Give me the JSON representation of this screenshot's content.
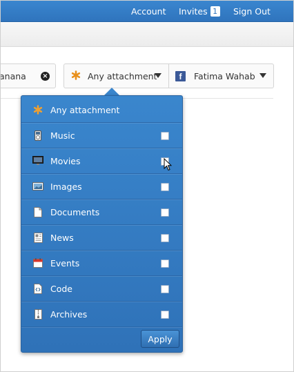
{
  "topnav": {
    "account": "Account",
    "invites": "Invites",
    "invites_count": "1",
    "signout": "Sign Out"
  },
  "filters": {
    "search_value": "anana",
    "attachment_selected": "Any attachment",
    "person_selected": "Fatima Wahab"
  },
  "dropdown": {
    "items": [
      {
        "label": "Any attachment",
        "icon": "asterisk-icon"
      },
      {
        "label": "Music",
        "icon": "ipod-icon"
      },
      {
        "label": "Movies",
        "icon": "monitor-icon"
      },
      {
        "label": "Images",
        "icon": "image-icon"
      },
      {
        "label": "Documents",
        "icon": "document-icon"
      },
      {
        "label": "News",
        "icon": "news-icon"
      },
      {
        "label": "Events",
        "icon": "calendar-icon"
      },
      {
        "label": "Code",
        "icon": "code-icon"
      },
      {
        "label": "Archives",
        "icon": "archive-icon"
      }
    ],
    "apply_label": "Apply"
  },
  "colors": {
    "brand_blue": "#2f74bd",
    "dropdown_blue": "#3a86cd"
  }
}
